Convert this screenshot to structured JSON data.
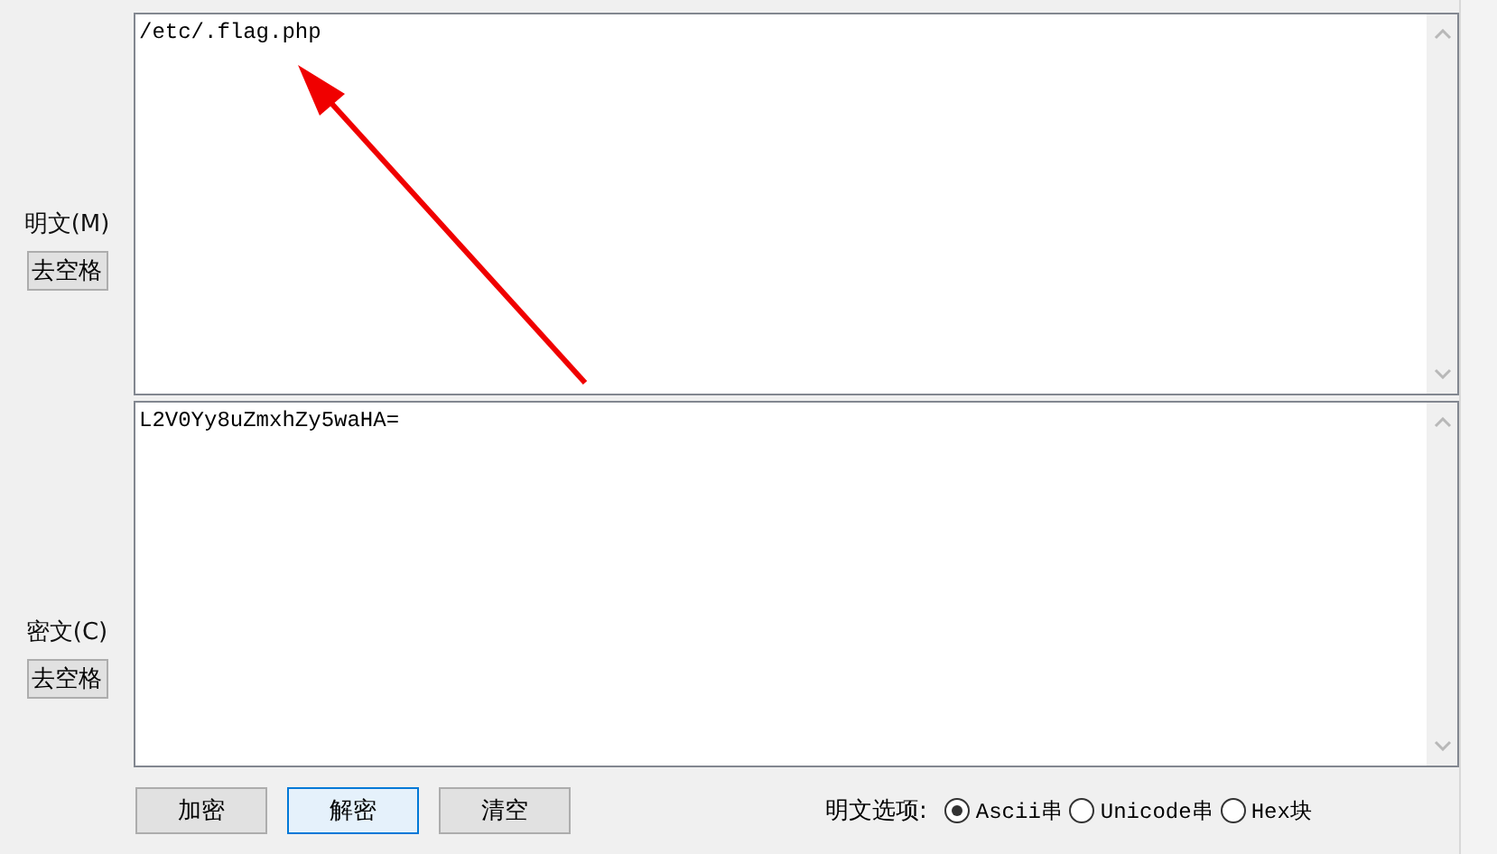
{
  "fields": [
    {
      "label": "明文(M)",
      "button": "去空格",
      "value": "/etc/.flag.php"
    },
    {
      "label": "密文(C)",
      "button": "去空格",
      "value": "L2V0Yy8uZmxhZy5waHA="
    }
  ],
  "actions": [
    {
      "label": "加密",
      "focused": false
    },
    {
      "label": "解密",
      "focused": true
    },
    {
      "label": "清空",
      "focused": false
    }
  ],
  "options": {
    "label": "明文选项:",
    "choices": [
      {
        "label": "Ascii串",
        "selected": true
      },
      {
        "label": "Unicode串",
        "selected": false
      },
      {
        "label": "Hex块",
        "selected": false
      }
    ]
  }
}
